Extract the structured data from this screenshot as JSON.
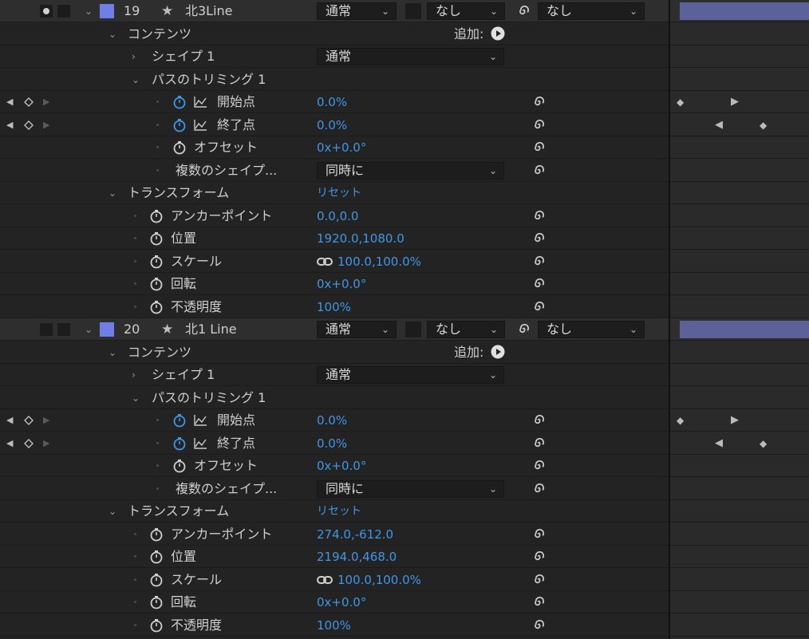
{
  "layers": [
    {
      "number": "19",
      "name": "北3Line",
      "mode": "通常",
      "trkmat": "なし",
      "parent": "なし",
      "contents_label": "コンテンツ",
      "add_label": "追加:",
      "shape_label": "シェイプ 1",
      "shape_mode": "通常",
      "trim_label": "パスのトリミング 1",
      "start_label": "開始点",
      "start_value": "0.0%",
      "end_label": "終了点",
      "end_value": "0.0%",
      "offset_label": "オフセット",
      "offset_value": "0x+0.0°",
      "multi_label": "複数のシェイプ...",
      "multi_value": "同時に",
      "transform_label": "トランスフォーム",
      "reset_label": "リセット",
      "anchor_label": "アンカーポイント",
      "anchor_value": "0.0,0.0",
      "position_label": "位置",
      "position_value": "1920.0,1080.0",
      "scale_label": "スケール",
      "scale_value": "100.0,100.0%",
      "rotation_label": "回転",
      "rotation_value": "0x+0.0°",
      "opacity_label": "不透明度",
      "opacity_value": "100%"
    },
    {
      "number": "20",
      "name": "北1 Line",
      "mode": "通常",
      "trkmat": "なし",
      "parent": "なし",
      "contents_label": "コンテンツ",
      "add_label": "追加:",
      "shape_label": "シェイプ 1",
      "shape_mode": "通常",
      "trim_label": "パスのトリミング 1",
      "start_label": "開始点",
      "start_value": "0.0%",
      "end_label": "終了点",
      "end_value": "0.0%",
      "offset_label": "オフセット",
      "offset_value": "0x+0.0°",
      "multi_label": "複数のシェイプ...",
      "multi_value": "同時に",
      "transform_label": "トランスフォーム",
      "reset_label": "リセット",
      "anchor_label": "アンカーポイント",
      "anchor_value": "274.0,-612.0",
      "position_label": "位置",
      "position_value": "2194.0,468.0",
      "scale_label": "スケール",
      "scale_value": "100.0,100.0%",
      "rotation_label": "回転",
      "rotation_value": "0x+0.0°",
      "opacity_label": "不透明度",
      "opacity_value": "100%"
    }
  ],
  "colors": {
    "accent_value": "#3f97e6",
    "layer_label": "#6f7fe6",
    "timeline_bar": "#5c6299"
  },
  "icons": [
    "eye-icon",
    "stopwatch-icon",
    "graph-icon",
    "pickwhip-icon",
    "link-icon",
    "star-icon",
    "keyframe-icon",
    "play-icon"
  ]
}
